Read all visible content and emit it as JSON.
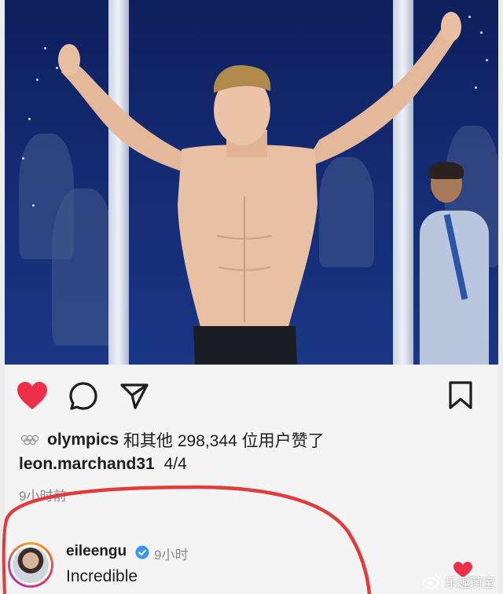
{
  "post": {
    "likes_text": "olympics 和其他 298,344 位用户赞了",
    "likes_user": "olympics",
    "likes_rest": "和其他 298,344 位用户赞了",
    "caption_user": "leon.marchand31",
    "caption_text": "4/4",
    "time_ago": "9小时前"
  },
  "comment": {
    "user": "eileengu",
    "time": "9小时",
    "text": "Incredible"
  },
  "watermark": {
    "text": "乐趣萌宝"
  },
  "icons": {
    "like": "heart-icon",
    "comment": "comment-icon",
    "share": "share-icon",
    "save": "bookmark-icon",
    "verified": "verified-icon",
    "comment_like": "heart-icon"
  },
  "colors": {
    "like_red": "#ed3048",
    "verified_blue": "#3897f0",
    "annotation_red": "#e33b3b"
  }
}
